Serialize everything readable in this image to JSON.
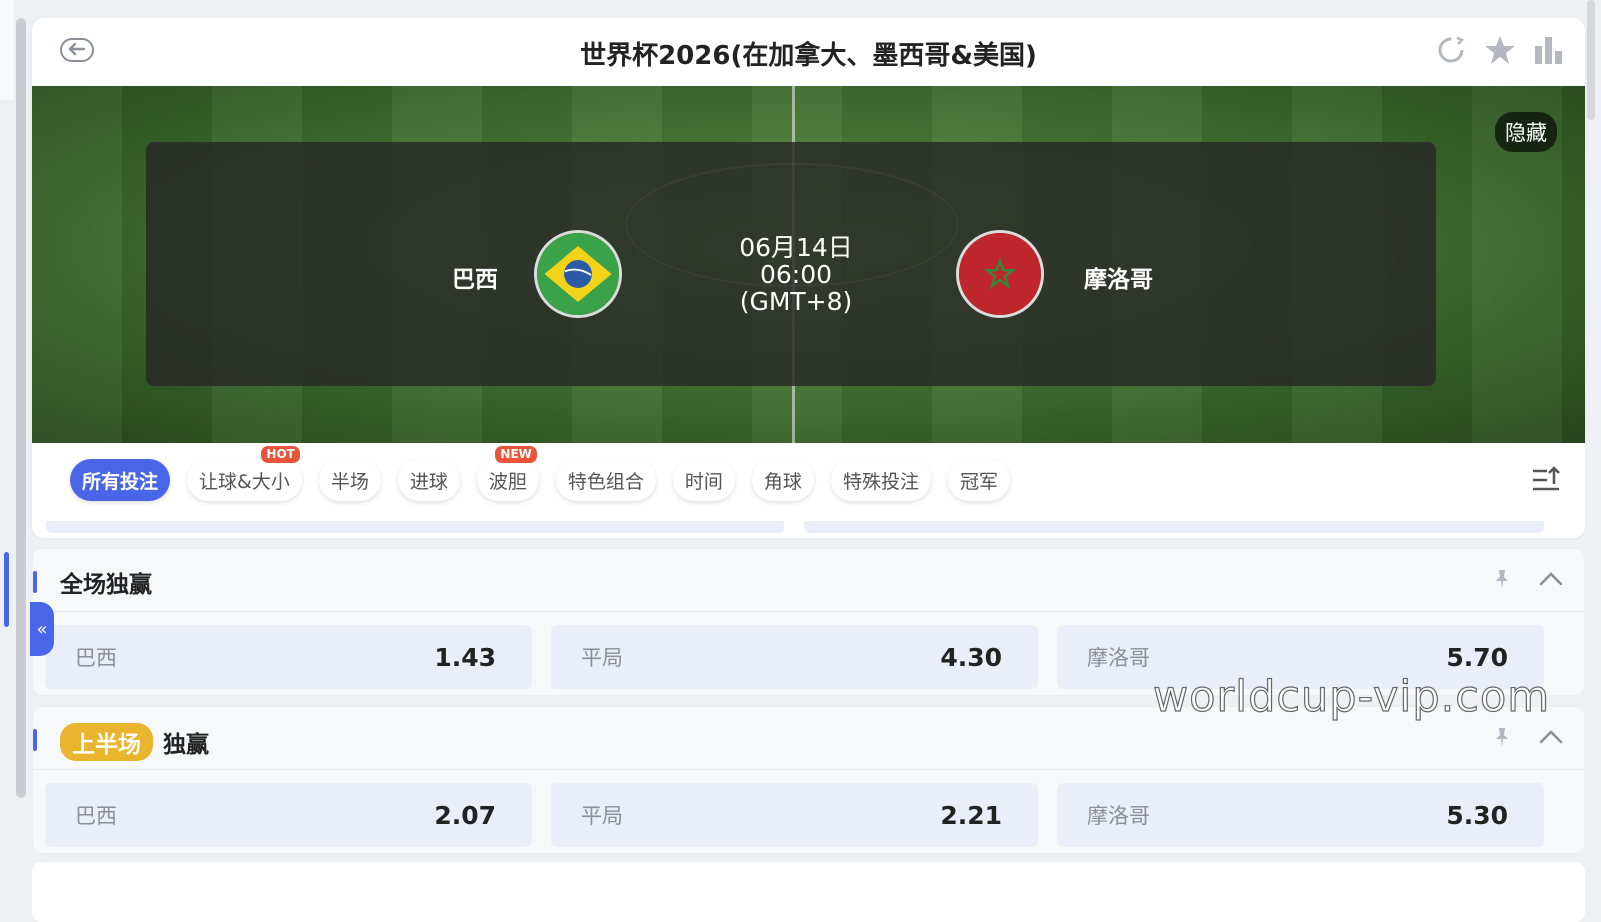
{
  "header": {
    "title": "世界杯2026(在加拿大、墨西哥&美国)"
  },
  "hero": {
    "hide_label": "隐藏",
    "home_team": "巴西",
    "away_team": "摩洛哥",
    "date": "06月14日",
    "time": "06:00",
    "timezone": "(GMT+8)"
  },
  "tabs": [
    {
      "label": "所有投注",
      "active": true
    },
    {
      "label": "让球&大小",
      "badge": "HOT"
    },
    {
      "label": "半场"
    },
    {
      "label": "进球"
    },
    {
      "label": "波胆",
      "badge": "NEW"
    },
    {
      "label": "特色组合"
    },
    {
      "label": "时间"
    },
    {
      "label": "角球"
    },
    {
      "label": "特殊投注"
    },
    {
      "label": "冠军"
    }
  ],
  "markets": [
    {
      "title": "全场独赢",
      "tag": "",
      "odds": [
        {
          "label": "巴西",
          "value": "1.43"
        },
        {
          "label": "平局",
          "value": "4.30"
        },
        {
          "label": "摩洛哥",
          "value": "5.70"
        }
      ]
    },
    {
      "title": "独赢",
      "tag": "上半场",
      "odds": [
        {
          "label": "巴西",
          "value": "2.07"
        },
        {
          "label": "平局",
          "value": "2.21"
        },
        {
          "label": "摩洛哥",
          "value": "5.30"
        }
      ]
    }
  ],
  "watermark": "worldcup-vip.com",
  "colors": {
    "accent": "#4a66e8",
    "hot_badge": "#e8553a",
    "half_tag": "#e9b52e",
    "odds_bg": "#e9eefa"
  }
}
